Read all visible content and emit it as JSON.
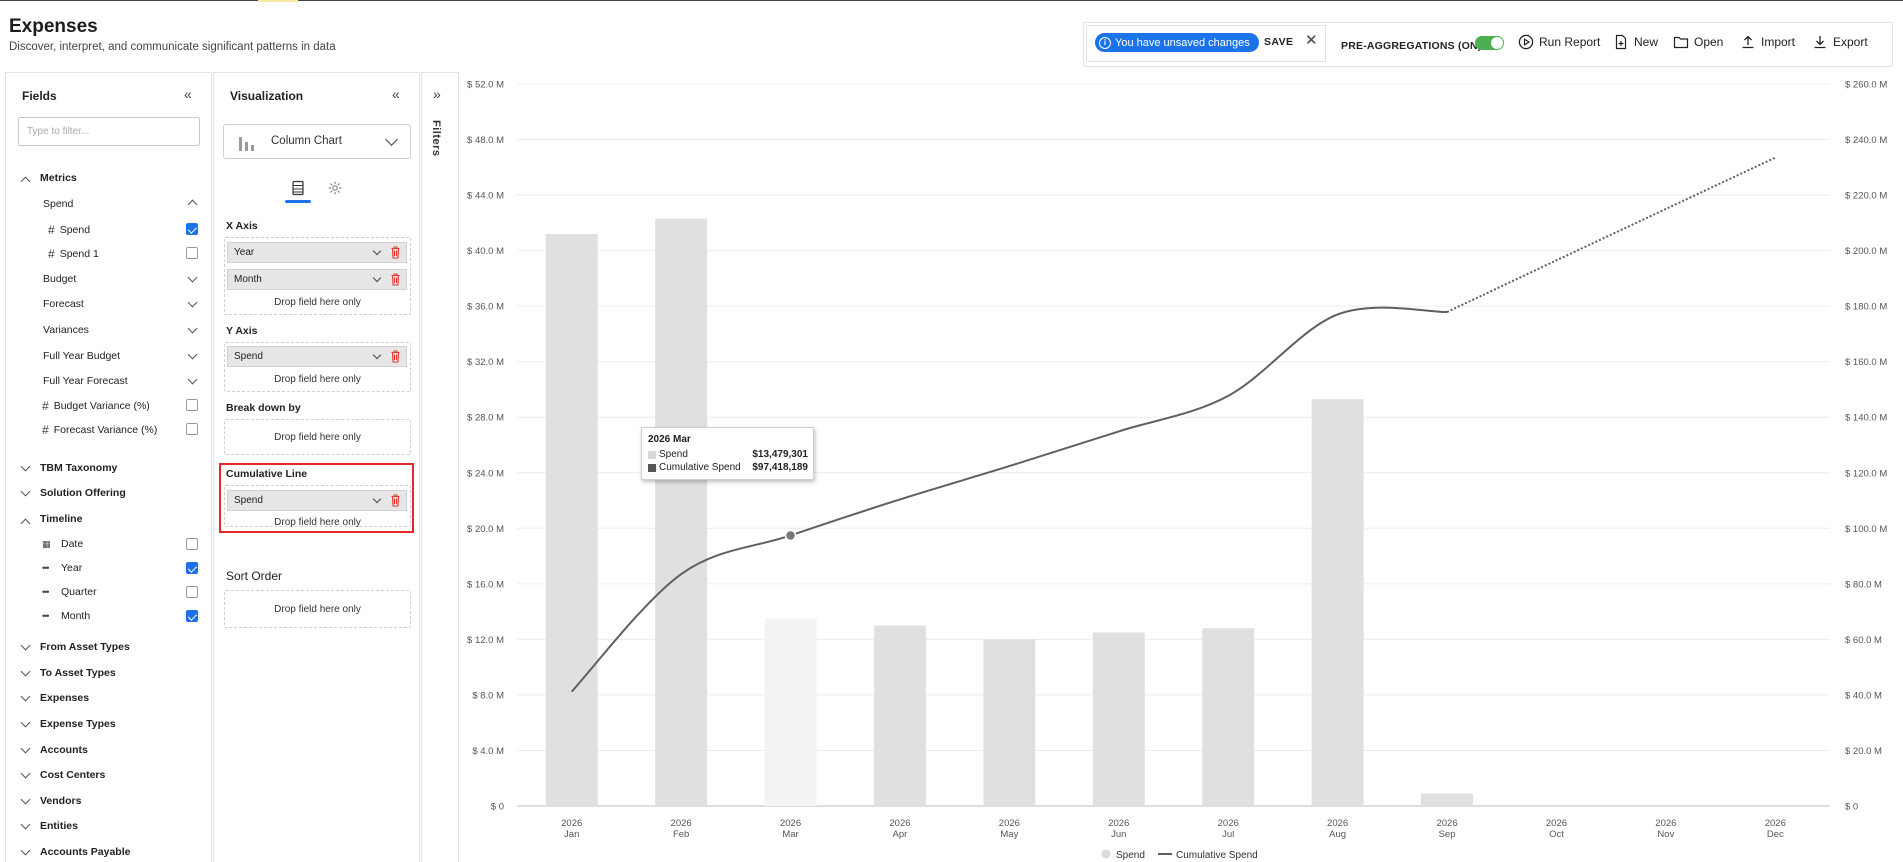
{
  "page": {
    "title": "Expenses",
    "subtitle": "Discover, interpret, and communicate significant patterns in data"
  },
  "toolbar": {
    "unsaved_label": "You have unsaved changes",
    "save_label": "SAVE",
    "preagg_label": "PRE-AGGREGATIONS (ON)",
    "preagg_on": true,
    "run_report_label": "Run Report",
    "new_label": "New",
    "open_label": "Open",
    "import_label": "Import",
    "export_label": "Export"
  },
  "fields": {
    "title": "Fields",
    "filter_placeholder": "Type to filter...",
    "metrics_label": "Metrics",
    "spend_group_label": "Spend",
    "spend_items": [
      {
        "label": "Spend",
        "checked": true
      },
      {
        "label": "Spend 1",
        "checked": false
      }
    ],
    "metric_groups": [
      "Budget",
      "Forecast",
      "Variances",
      "Full Year Budget",
      "Full Year Forecast"
    ],
    "metric_items": [
      {
        "label": "Budget Variance (%)",
        "checked": false
      },
      {
        "label": "Forecast Variance (%)",
        "checked": false
      }
    ],
    "sections_a": [
      "TBM Taxonomy",
      "Solution Offering"
    ],
    "timeline_label": "Timeline",
    "timeline_items": [
      {
        "label": "Date",
        "checked": false,
        "icon": "calendar-icon"
      },
      {
        "label": "Year",
        "checked": true,
        "icon": "dimension-icon"
      },
      {
        "label": "Quarter",
        "checked": false,
        "icon": "dimension-icon"
      },
      {
        "label": "Month",
        "checked": true,
        "icon": "dimension-icon"
      }
    ],
    "sections_b": [
      "From Asset Types",
      "To Asset Types",
      "Expenses",
      "Expense Types",
      "Accounts",
      "Cost Centers",
      "Vendors",
      "Entities",
      "Accounts Payable"
    ]
  },
  "visualization": {
    "title": "Visualization",
    "chart_type": "Column Chart",
    "x_axis_label": "X Axis",
    "x_axis_fields": [
      "Year",
      "Month"
    ],
    "y_axis_label": "Y Axis",
    "y_axis_fields": [
      "Spend"
    ],
    "breakdown_label": "Break down by",
    "cumulative_label": "Cumulative Line",
    "cumulative_fields": [
      "Spend"
    ],
    "sort_label": "Sort Order",
    "drop_hint": "Drop field here only"
  },
  "filters": {
    "label": "Filters"
  },
  "tooltip": {
    "title": "2026 Mar",
    "rows": [
      {
        "label": "Spend",
        "value": "$13,479,301",
        "color": "#d9d9d9"
      },
      {
        "label": "Cumulative Spend",
        "value": "$97,418,189",
        "color": "#555555"
      }
    ]
  },
  "colors": {
    "bar": "#e0e0e0",
    "bar_hover": "#f3f3f3",
    "line": "#5f5f5f",
    "accent": "#1a73e8",
    "highlight": "#e32a2a",
    "toggle_on": "#4caf50"
  },
  "chart_data": {
    "type": "bar",
    "categories": [
      "2026 Jan",
      "2026 Feb",
      "2026 Mar",
      "2026 Apr",
      "2026 May",
      "2026 Jun",
      "2026 Jul",
      "2026 Aug",
      "2026 Sep",
      "2026 Oct",
      "2026 Nov",
      "2026 Dec"
    ],
    "tick_years": [
      "2026",
      "2026",
      "2026",
      "2026",
      "2026",
      "2026",
      "2026",
      "2026",
      "2026",
      "2026",
      "2026",
      "2026"
    ],
    "tick_months": [
      "Jan",
      "Feb",
      "Mar",
      "Apr",
      "May",
      "Jun",
      "Jul",
      "Aug",
      "Sep",
      "Oct",
      "Nov",
      "Dec"
    ],
    "series": [
      {
        "name": "Spend",
        "axis": "left",
        "kind": "column",
        "values": [
          41.2,
          42.3,
          13.48,
          13.0,
          12.0,
          12.5,
          12.8,
          29.3,
          0.9,
          null,
          null,
          null
        ]
      },
      {
        "name": "Cumulative Spend",
        "axis": "right",
        "kind": "line",
        "values": [
          41.2,
          83.5,
          97.42,
          110.4,
          122.4,
          134.9,
          147.7,
          177.0,
          177.9,
          196.5,
          215.0,
          233.5
        ],
        "projected_from_index": 8
      }
    ],
    "hovered_index": 2,
    "y_left": {
      "min": 0,
      "max": 52,
      "step": 4,
      "format": "$ {v}.0 M"
    },
    "y_right": {
      "min": 0,
      "max": 260,
      "step": 20,
      "format": "$ {v}.0 M"
    },
    "y_left_ticks": [
      "$ 0",
      "$ 4.0 M",
      "$ 8.0 M",
      "$ 12.0 M",
      "$ 16.0 M",
      "$ 20.0 M",
      "$ 24.0 M",
      "$ 28.0 M",
      "$ 32.0 M",
      "$ 36.0 M",
      "$ 40.0 M",
      "$ 44.0 M",
      "$ 48.0 M",
      "$ 52.0 M"
    ],
    "y_right_ticks": [
      "$ 0",
      "$ 20.0 M",
      "$ 40.0 M",
      "$ 60.0 M",
      "$ 80.0 M",
      "$ 100.0 M",
      "$ 120.0 M",
      "$ 140.0 M",
      "$ 160.0 M",
      "$ 180.0 M",
      "$ 200.0 M",
      "$ 220.0 M",
      "$ 240.0 M",
      "$ 260.0 M"
    ],
    "grid": true,
    "legend_position": "bottom-center",
    "legend": [
      "Spend",
      "Cumulative Spend"
    ]
  }
}
